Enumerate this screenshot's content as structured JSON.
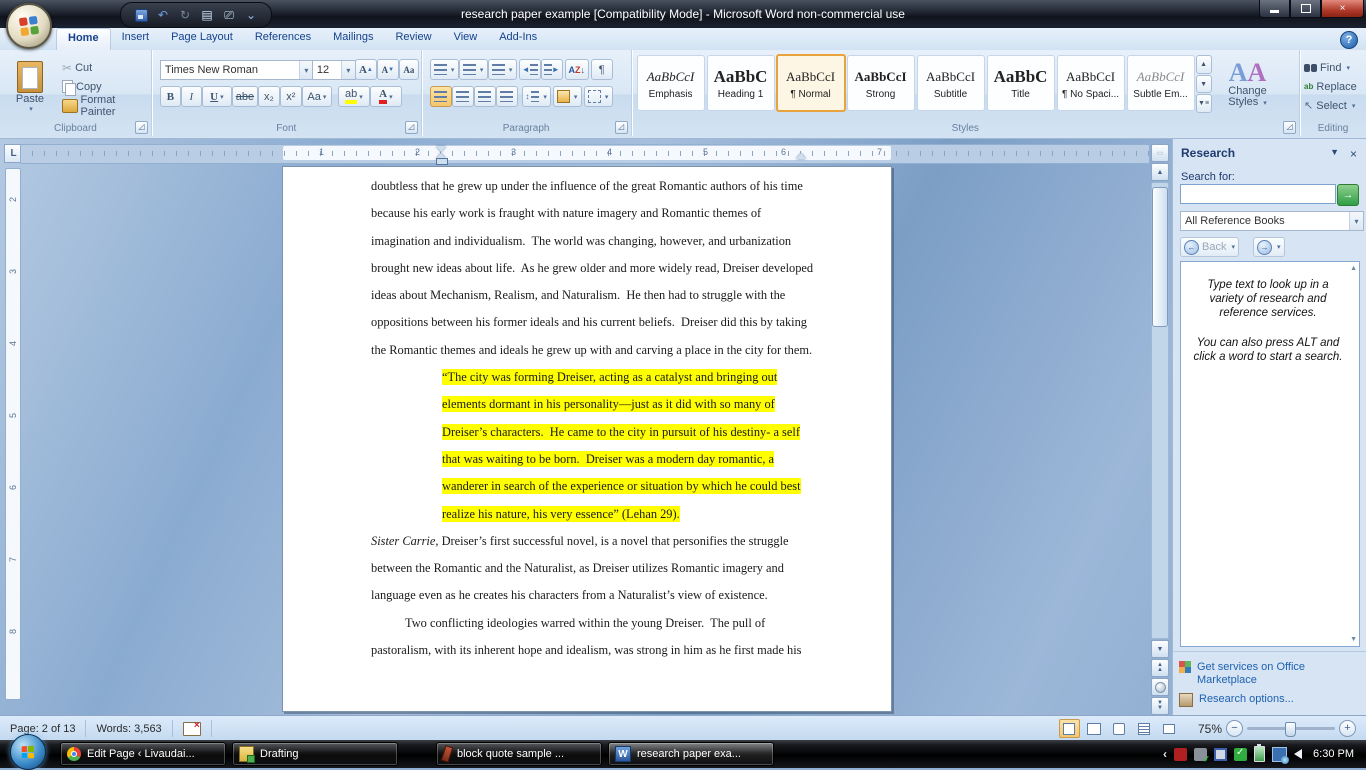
{
  "icons": {
    "dropdown": "▾",
    "up": "▲",
    "down": "▼",
    "left": "◄",
    "right": "►",
    "close": "×",
    "help": "?",
    "pilcrow": "¶",
    "minus": "−",
    "plus": "+",
    "go_arrow": "→",
    "back_circle": "←",
    "fwd_circle": "→",
    "chevron": "‹",
    "sort": "A↓",
    "scissors": "✂",
    "select_arrow": "↖",
    "qat_more": "⌄"
  },
  "title_bar": {
    "title": "research paper example [Compatibility Mode]  -  Microsoft Word non-commercial use"
  },
  "ribbon": {
    "tabs": [
      {
        "label": "Home"
      },
      {
        "label": "Insert"
      },
      {
        "label": "Page Layout"
      },
      {
        "label": "References"
      },
      {
        "label": "Mailings"
      },
      {
        "label": "Review"
      },
      {
        "label": "View"
      },
      {
        "label": "Add-Ins"
      }
    ],
    "clipboard": {
      "label": "Clipboard",
      "paste": "Paste",
      "cut": "Cut",
      "copy": "Copy",
      "format_painter": "Format Painter"
    },
    "font": {
      "label": "Font",
      "family": "Times New Roman",
      "size": "12",
      "bold": "B",
      "italic": "I",
      "underline": "U",
      "strike": "abe",
      "subscript": "x₂",
      "superscript": "x²",
      "case": "Aa",
      "grow": "A",
      "shrink": "A",
      "clear": "Aa",
      "highlight": "ab",
      "color": "A"
    },
    "paragraph": {
      "label": "Paragraph"
    },
    "styles": {
      "label": "Styles",
      "change_styles": "Change Styles",
      "items": [
        {
          "preview": "AaBbCcI",
          "label": "Emphasis"
        },
        {
          "preview": "AaBbC",
          "label": "Heading 1"
        },
        {
          "preview": "AaBbCcI",
          "label": "¶ Normal"
        },
        {
          "preview": "AaBbCcI",
          "label": "Strong"
        },
        {
          "preview": "AaBbCcI",
          "label": "Subtitle"
        },
        {
          "preview": "AaBbC",
          "label": "Title"
        },
        {
          "preview": "AaBbCcI",
          "label": "¶ No Spaci..."
        },
        {
          "preview": "AaBbCcI",
          "label": "Subtle Em..."
        }
      ]
    },
    "editing": {
      "label": "Editing",
      "find": "Find",
      "replace": "Replace",
      "select": "Select"
    }
  },
  "ruler": {
    "tab_selector": "L",
    "h_numbers": [
      "1",
      "2",
      "3",
      "4",
      "5",
      "6",
      "7"
    ],
    "v_numbers": [
      "2",
      "3",
      "4",
      "5",
      "6",
      "7",
      "8"
    ]
  },
  "document": {
    "para1_lines": [
      "doubtless that he grew up under the influence of the great Romantic authors of his time",
      "because his early work is fraught with nature imagery and Romantic themes of",
      "imagination and individualism.  The world was changing, however, and urbanization",
      "brought new ideas about life.  As he grew older and more widely read, Dreiser developed",
      "ideas about Mechanism, Realism, and Naturalism.  He then had to struggle with the",
      "oppositions between his former ideals and his current beliefs.  Dreiser did this by taking",
      "the Romantic themes and ideals he grew up with and carving a place in the city for them."
    ],
    "quote_lines": [
      "“The city was forming Dreiser, acting as a catalyst and bringing out",
      "elements dormant in his personality—just as it did with so many of",
      "Dreiser’s characters.  He came to the city in pursuit of his destiny- a self",
      "that was waiting to be born.  Dreiser was a modern day romantic, a",
      "wanderer in search of the experience or situation by which he could best",
      "realize his nature, his very essence” (Lehan 29)."
    ],
    "para2_lead_italic": "Sister Carrie,",
    "para2_line1_rest": " Dreiser’s first successful novel, is a novel that personifies the struggle",
    "para2_lines": [
      "between the Romantic and the Naturalist, as Dreiser utilizes Romantic imagery and",
      "language even as he creates his characters from a Naturalist’s view of existence."
    ],
    "para3_lines": [
      "Two conflicting ideologies warred within the young Dreiser.  The pull of",
      "pastoralism, with its inherent hope and idealism, was strong in him as he first made his"
    ],
    "highlight_color": "#ffff00"
  },
  "research": {
    "title": "Research",
    "search_label": "Search for:",
    "search_value": "",
    "source_select": "All Reference Books",
    "back_label": "Back",
    "instructions1": "Type text to look up in a variety of research and reference services.",
    "instructions2": "You can also press ALT and click a word to start a search.",
    "link_marketplace": "Get services on Office Marketplace",
    "link_options": "Research options..."
  },
  "status_bar": {
    "page": "Page: 2 of 13",
    "words": "Words: 3,563",
    "zoom": "75%"
  },
  "taskbar": {
    "buttons": [
      {
        "label": "Edit Page ‹ Livaudai..."
      },
      {
        "label": "Drafting"
      },
      {
        "label": "block quote sample ..."
      },
      {
        "label": "research paper exa..."
      }
    ],
    "time": "6:30 PM"
  },
  "colors": {
    "accent_orange": "#e8a33d",
    "highlight_yellow": "#ffff00",
    "link_blue": "#1f62b0",
    "tab_text_blue": "#15428b"
  }
}
